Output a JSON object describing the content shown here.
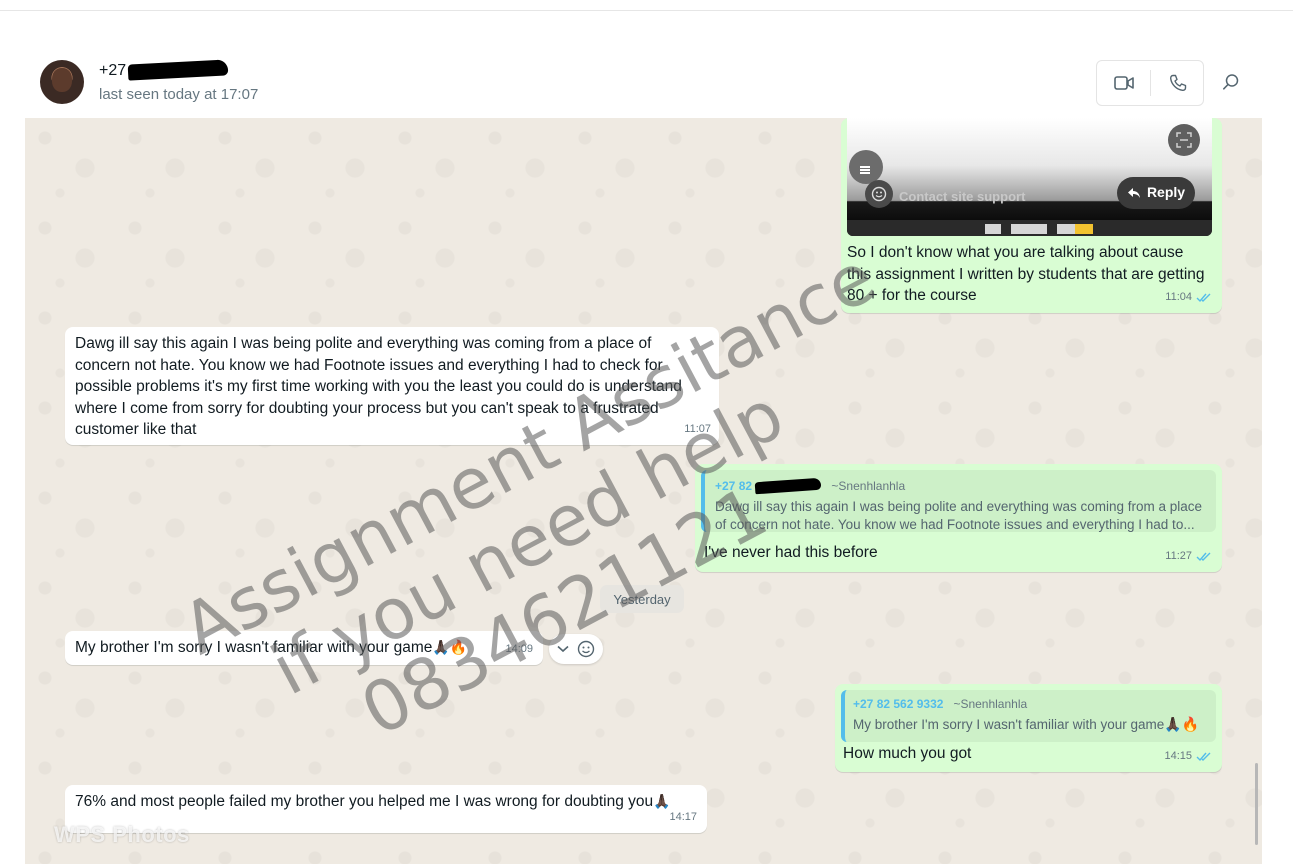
{
  "contact": {
    "name_prefix": "+27",
    "last_seen": "last seen today at 17:07"
  },
  "messages": [
    {
      "direction": "outgoing",
      "image": {
        "support_text": "Contact site support",
        "reply_label": "Reply"
      },
      "text": "So I don't know what you are talking about cause this assignment I written by students that are getting 80 + for the course",
      "time": "11:04",
      "ticks": "read"
    },
    {
      "direction": "incoming",
      "text": "Dawg ill say this again I was being polite and everything was coming from a place of concern not hate. You know we had Footnote issues and everything I had to check for possible problems it's my first time working with you the least you could do is understand where I come from sorry for doubting your process but you can't speak to a frustrated customer like that",
      "time": "11:07"
    },
    {
      "direction": "outgoing",
      "quote": {
        "sender_prefix": "+27 82",
        "sender_name": "~Snenhlanhla",
        "text": "Dawg ill say this again I was being polite and everything was coming from a place of concern not hate. You know we had Footnote issues and everything I had to..."
      },
      "text": "I've never had this before",
      "time": "11:27",
      "ticks": "read"
    },
    {
      "direction": "incoming",
      "text": "My brother I'm sorry I wasn't familiar with your game",
      "emoji": "🙏🏿🔥",
      "time": "14:09"
    },
    {
      "direction": "outgoing",
      "quote": {
        "sender_prefix": "+27 82 562 9332",
        "sender_name": "~Snenhlanhla",
        "text": "My brother I'm sorry I wasn't familiar with your game",
        "emoji": "🙏🏿🔥"
      },
      "text": "How much you got",
      "time": "14:15",
      "ticks": "read"
    },
    {
      "direction": "incoming",
      "text": "76% and most people failed my brother you helped me I was wrong for doubting you",
      "emoji": "🙏🏿",
      "time": "14:17"
    }
  ],
  "day_separator": "Yesterday",
  "watermark": {
    "line1": "Assignment Assitance",
    "line2": "if you need help",
    "line3": "0834621121",
    "app_label": "WPS Photos"
  },
  "icons": {
    "video": "video-camera-icon",
    "phone": "phone-icon",
    "search": "search-icon",
    "tick": "double-check-icon",
    "reaction": "smiley-icon"
  },
  "colors": {
    "incoming_bubble": "#ffffff",
    "outgoing_bubble": "#d9fdd3",
    "chat_background": "#efeae2",
    "read_tick": "#53bdeb",
    "quote_accent": "#53bdeb"
  }
}
